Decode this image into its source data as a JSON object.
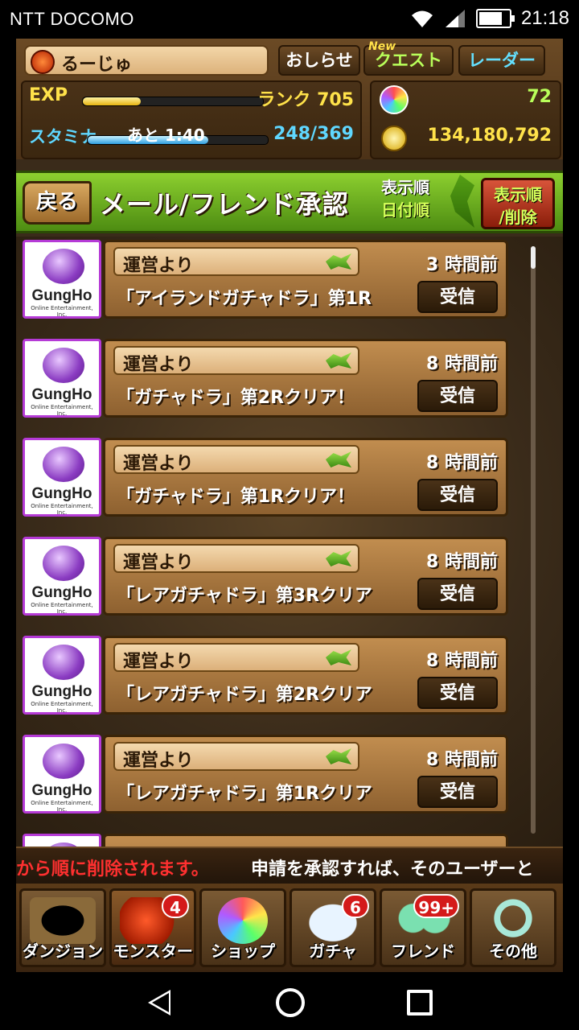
{
  "status_bar": {
    "carrier": "NTT DOCOMO",
    "time": "21:18"
  },
  "header": {
    "player_name": "るーじゅ",
    "buttons": {
      "news": "おしらせ",
      "new_tag": "New",
      "quest": "クエスト",
      "radar": "レーダー"
    },
    "exp_label": "EXP",
    "rank": "ランク 705",
    "stamina_label": "スタミナ",
    "stamina_remaining": "あと 1:40",
    "stamina_value": "248/369",
    "magic_stones": "72",
    "coins": "134,180,792"
  },
  "title_bar": {
    "back": "戻る",
    "title": "メール/フレンド承認",
    "sort_label_1": "表示順",
    "sort_label_2": "日付順",
    "sort_delete_1": "表示順",
    "sort_delete_2": "/削除"
  },
  "mails": [
    {
      "sender": "運営より",
      "time": "3 時間前",
      "subject": "「アイランドガチャドラ」第1R",
      "action": "受信"
    },
    {
      "sender": "運営より",
      "time": "8 時間前",
      "subject": "「ガチャドラ」第2Rクリア！",
      "action": "受信"
    },
    {
      "sender": "運営より",
      "time": "8 時間前",
      "subject": "「ガチャドラ」第1Rクリア！",
      "action": "受信"
    },
    {
      "sender": "運営より",
      "time": "8 時間前",
      "subject": "「レアガチャドラ」第3Rクリア",
      "action": "受信"
    },
    {
      "sender": "運営より",
      "time": "8 時間前",
      "subject": "「レアガチャドラ」第2Rクリア",
      "action": "受信"
    },
    {
      "sender": "運営より",
      "time": "8 時間前",
      "subject": "「レアガチャドラ」第1Rクリア",
      "action": "受信"
    }
  ],
  "avatar": {
    "brand": "GungHo",
    "sub": "Online Entertainment, Inc."
  },
  "ticker": {
    "red": "から順に削除されます。",
    "white": "申請を承認すれば、そのユーザーと"
  },
  "bottom_nav": [
    {
      "label": "ダンジョン",
      "badge": ""
    },
    {
      "label": "モンスター",
      "badge": "4"
    },
    {
      "label": "ショップ",
      "badge": ""
    },
    {
      "label": "ガチャ",
      "badge": "6"
    },
    {
      "label": "フレンド",
      "badge": "99+"
    },
    {
      "label": "その他",
      "badge": ""
    }
  ],
  "colors": {
    "stamina": "#5fd7ff",
    "exp": "#ffe24a",
    "accent_green": "#8ccf2f",
    "badge": "#d41a1a",
    "avatar_border": "#b53ad6"
  }
}
